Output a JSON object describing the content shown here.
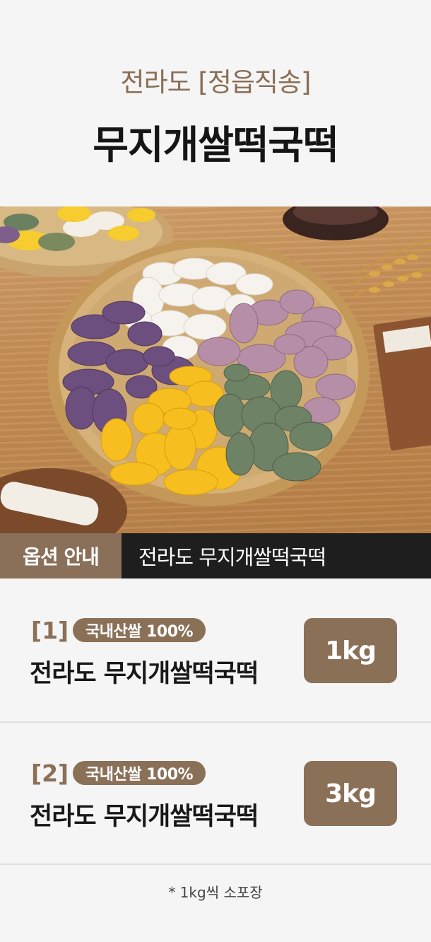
{
  "header": {
    "subtitle": "전라도 [정읍직송]",
    "title": "무지개쌀떡국떡"
  },
  "banner": {
    "label": "옵션 안내",
    "product": "전라도 무지개쌀떡국떡"
  },
  "options": [
    {
      "number": "[1]",
      "badge": "국내산쌀 100%",
      "name": "전라도 무지개쌀떡국떡",
      "weight": "1kg"
    },
    {
      "number": "[2]",
      "badge": "국내산쌀 100%",
      "name": "전라도 무지개쌀떡국떡",
      "weight": "3kg"
    }
  ],
  "footnote": "* 1kg씩 소포장",
  "colors": {
    "brand_brown": "#8b7058",
    "banner_dark": "#1e1e1e",
    "background": "#f5f5f5"
  }
}
